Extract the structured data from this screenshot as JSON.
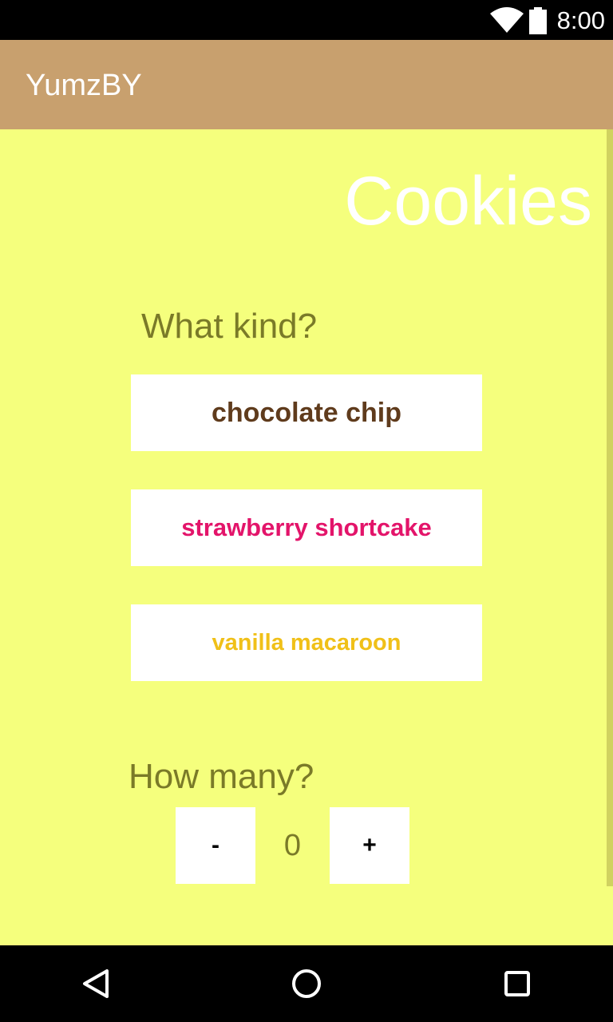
{
  "status_bar": {
    "time": "8:00",
    "icons": [
      "wifi-icon",
      "battery-icon"
    ]
  },
  "app_bar": {
    "title": "YumzBY",
    "color": "#c8a06e"
  },
  "main": {
    "heading": "Cookies",
    "kind_label": "What kind?",
    "options": [
      {
        "label": "chocolate chip",
        "color": "#5f3b1c"
      },
      {
        "label": "strawberry shortcake",
        "color": "#e3146a"
      },
      {
        "label": "vanilla macaroon",
        "color": "#f0c018"
      }
    ],
    "quantity_label": "How many?",
    "decrement_label": "-",
    "quantity_value": "0",
    "increment_label": "+",
    "background_color": "#f5ff7d"
  },
  "nav_bar": {
    "icons": [
      "back-icon",
      "home-icon",
      "recents-icon"
    ]
  }
}
